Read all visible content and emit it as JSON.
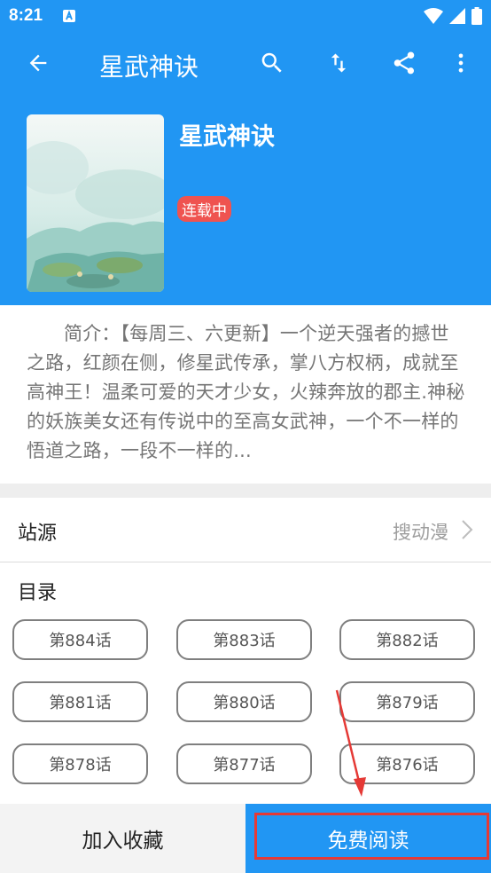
{
  "status_bar": {
    "time": "8:21"
  },
  "app_bar": {
    "title": "星武神诀"
  },
  "book": {
    "title": "星武神诀",
    "status_badge": "连载中"
  },
  "intro": {
    "text": "简介：【每周三、六更新】一个逆天强者的撼世之路，红颜在侧，修星武传承，掌八方权柄，成就至高神王！温柔可爱的天才少女，火辣奔放的郡主.神秘的妖族美女还有传说中的至高女武神，一个不一样的悟道之路，一段不一样的..."
  },
  "source": {
    "label": "站源",
    "value": "搜动漫"
  },
  "catalog": {
    "label": "目录",
    "chapters": [
      "第884话",
      "第883话",
      "第882话",
      "第881话",
      "第880话",
      "第879话",
      "第878话",
      "第877话",
      "第876话"
    ]
  },
  "bottom": {
    "collect_label": "加入收藏",
    "read_label": "免费阅读"
  },
  "colors": {
    "primary": "#2196f3",
    "badge": "#ef5350",
    "highlight": "#e53935"
  }
}
